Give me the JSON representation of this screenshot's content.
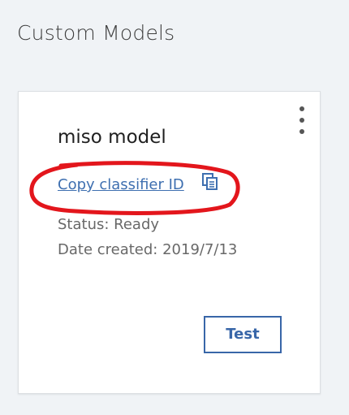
{
  "page": {
    "title": "Custom Models"
  },
  "card": {
    "model_name": "miso model",
    "copy_link_label": "Copy classifier ID",
    "copy_icon": "copy-icon",
    "status_text": "Status: Ready",
    "date_text": "Date created: 2019/7/13",
    "test_button_label": "Test",
    "menu_icon": "overflow-menu-icon"
  },
  "colors": {
    "page_background": "#f0f3f6",
    "link": "#3e6fb0",
    "button_border": "#3866a8",
    "highlight": "#e3161c"
  }
}
